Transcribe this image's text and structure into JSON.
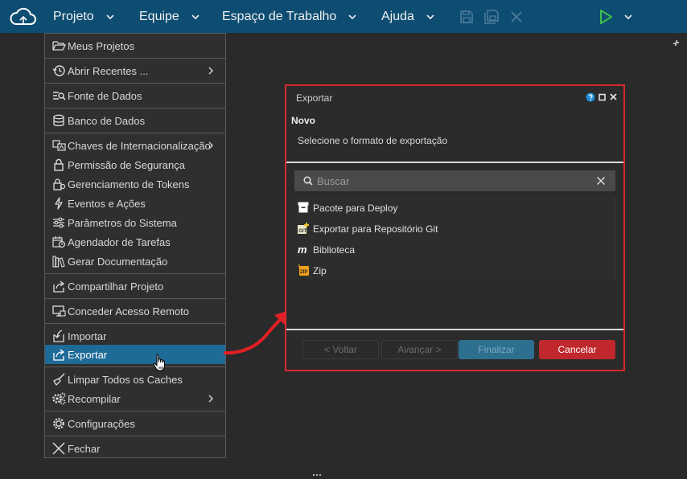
{
  "menubar": {
    "items": [
      {
        "label": "Projeto"
      },
      {
        "label": "Equipe"
      },
      {
        "label": "Espaço de Trabalho"
      },
      {
        "label": "Ajuda"
      }
    ]
  },
  "project_menu": {
    "items": [
      {
        "label": "Meus Projetos",
        "icon": "folder-open-icon"
      },
      {
        "label": "Abrir Recentes ...",
        "icon": "history-icon",
        "submenu": true
      },
      {
        "label": "Fonte de Dados",
        "icon": "data-source-icon"
      },
      {
        "label": "Banco de Dados",
        "icon": "database-icon"
      },
      {
        "label": "Chaves de Internacionalização",
        "icon": "translate-icon",
        "submenu": true
      },
      {
        "label": "Permissão de Segurança",
        "icon": "lock-icon"
      },
      {
        "label": "Gerenciamento de Tokens",
        "icon": "token-lock-icon"
      },
      {
        "label": "Eventos e Ações",
        "icon": "bolt-icon"
      },
      {
        "label": "Parâmetros do Sistema",
        "icon": "sliders-icon"
      },
      {
        "label": "Agendador de Tarefas",
        "icon": "calendar-clock-icon"
      },
      {
        "label": "Gerar Documentação",
        "icon": "books-icon"
      },
      {
        "label": "Compartilhar Projeto",
        "icon": "share-icon"
      },
      {
        "label": "Conceder Acesso Remoto",
        "icon": "remote-access-icon"
      },
      {
        "label": "Importar",
        "icon": "import-icon"
      },
      {
        "label": "Exportar",
        "icon": "export-icon",
        "active": true
      },
      {
        "label": "Limpar Todos os Caches",
        "icon": "broom-icon"
      },
      {
        "label": "Recompilar",
        "icon": "gears-icon",
        "submenu": true
      },
      {
        "label": "Configurações",
        "icon": "settings-icon"
      },
      {
        "label": "Fechar",
        "icon": "close-icon"
      }
    ]
  },
  "export_dialog": {
    "title": "Exportar",
    "heading": "Novo",
    "description": "Selecione o formato de exportação",
    "search_placeholder": "Buscar",
    "options": [
      {
        "label": "Pacote para Deploy",
        "icon": "package-icon"
      },
      {
        "label": "Exportar para Repositório Git",
        "icon": "git-icon"
      },
      {
        "label": "Biblioteca",
        "icon": "library-icon"
      },
      {
        "label": "Zip",
        "icon": "zip-icon"
      }
    ],
    "buttons": {
      "back": "< Voltar",
      "next": "Avançar >",
      "finish": "Finalizar",
      "cancel": "Cancelar"
    }
  },
  "colors": {
    "topbar": "#0e4d72",
    "menu_active": "#1f6b98",
    "cancel_button": "#c0282d",
    "finish_button": "#2c6f8f",
    "highlight_border": "#d9282e",
    "run_icon": "#3cc04a"
  }
}
